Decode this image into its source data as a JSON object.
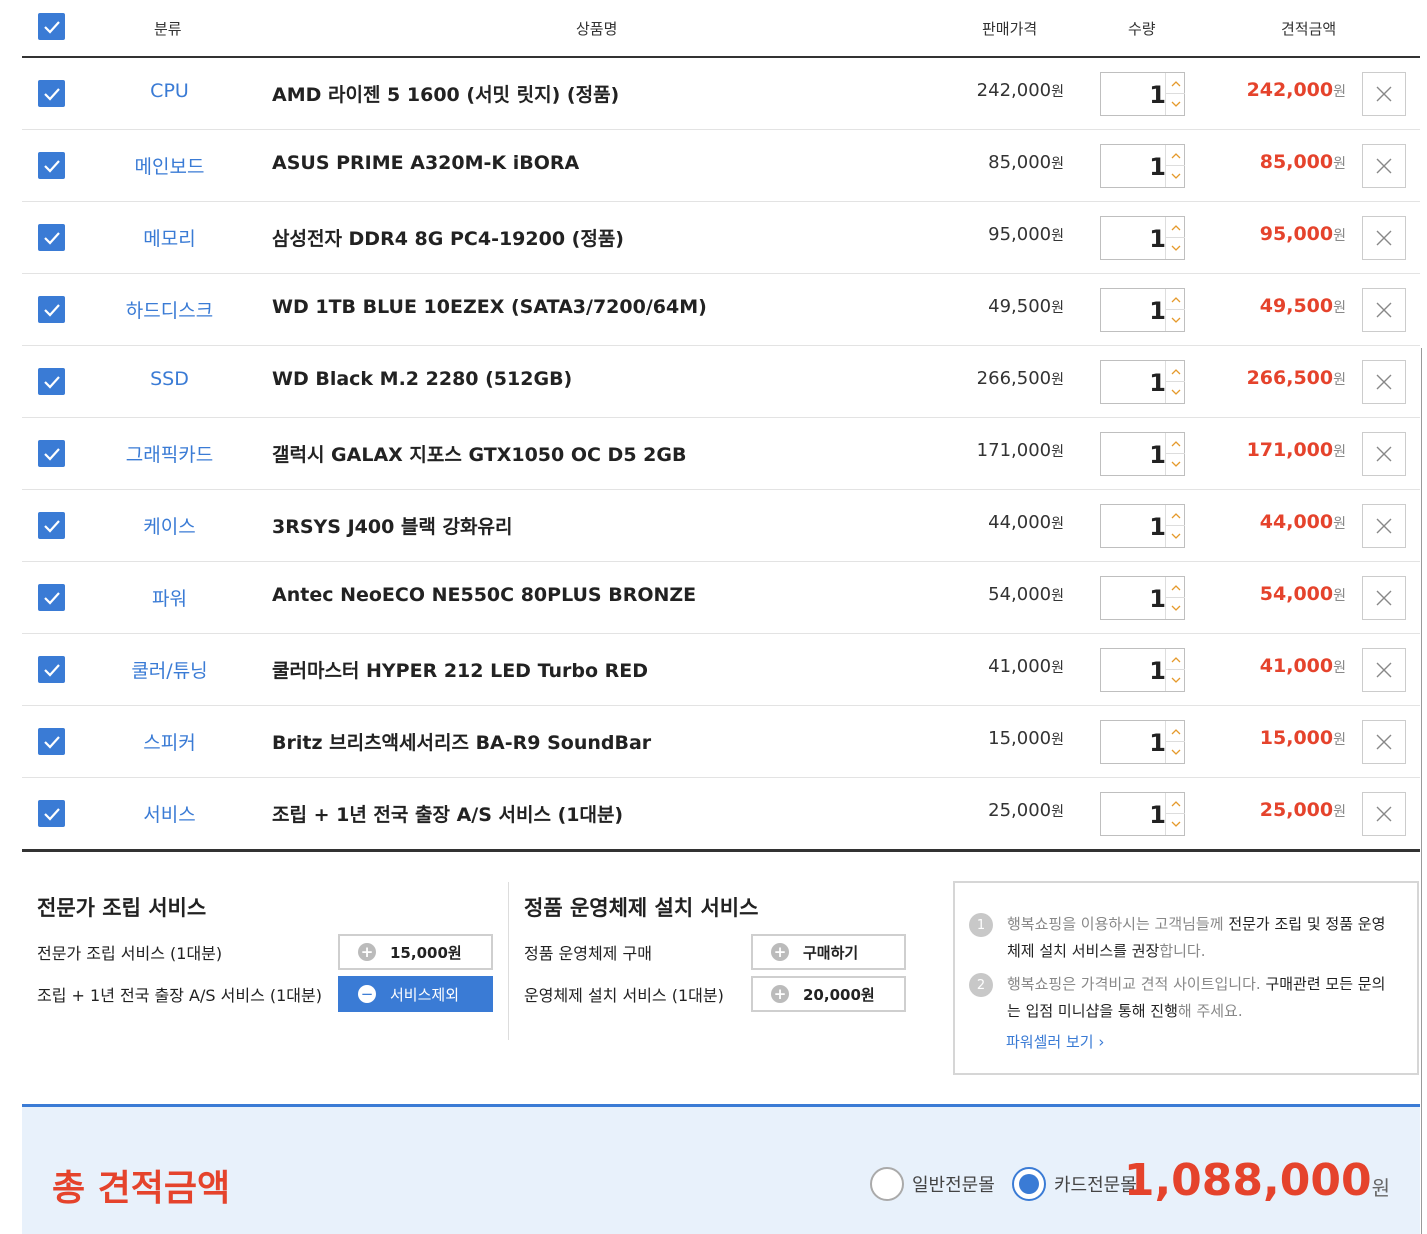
{
  "header": {
    "category": "분류",
    "product": "상품명",
    "price": "판매가격",
    "qty": "수량",
    "amount": "견적금액"
  },
  "won": "원",
  "rows": [
    {
      "category": "CPU",
      "name": "AMD 라이젠 5 1600 (서밋 릿지) (정품)",
      "price": "242,000",
      "qty": "1",
      "total": "242,000"
    },
    {
      "category": "메인보드",
      "name": "ASUS PRIME A320M-K iBORA",
      "price": "85,000",
      "qty": "1",
      "total": "85,000"
    },
    {
      "category": "메모리",
      "name": "삼성전자 DDR4 8G PC4-19200 (정품)",
      "price": "95,000",
      "qty": "1",
      "total": "95,000"
    },
    {
      "category": "하드디스크",
      "name": "WD 1TB BLUE 10EZEX (SATA3/7200/64M)",
      "price": "49,500",
      "qty": "1",
      "total": "49,500"
    },
    {
      "category": "SSD",
      "name": "WD Black M.2 2280 (512GB)",
      "price": "266,500",
      "qty": "1",
      "total": "266,500"
    },
    {
      "category": "그래픽카드",
      "name": "갤럭시 GALAX 지포스 GTX1050 OC D5 2GB",
      "price": "171,000",
      "qty": "1",
      "total": "171,000"
    },
    {
      "category": "케이스",
      "name": "3RSYS J400 블랙 강화유리",
      "price": "44,000",
      "qty": "1",
      "total": "44,000"
    },
    {
      "category": "파워",
      "name": "Antec NeoECO NE550C 80PLUS BRONZE",
      "price": "54,000",
      "qty": "1",
      "total": "54,000"
    },
    {
      "category": "쿨러/튜닝",
      "name": "쿨러마스터 HYPER 212 LED Turbo RED",
      "price": "41,000",
      "qty": "1",
      "total": "41,000"
    },
    {
      "category": "스피커",
      "name": "Britz 브리츠액세서리즈 BA-R9 SoundBar",
      "price": "15,000",
      "qty": "1",
      "total": "15,000"
    },
    {
      "category": "서비스",
      "name": "조립 + 1년 전국 출장 A/S 서비스 (1대분)",
      "price": "25,000",
      "qty": "1",
      "total": "25,000"
    }
  ],
  "assembly": {
    "title": "전문가 조립 서비스",
    "line1": "전문가 조립 서비스 (1대분)",
    "line1_button": "15,000원",
    "line2": "조립 + 1년 전국 출장 A/S 서비스 (1대분)",
    "line2_button": "서비스제외"
  },
  "os": {
    "title": "정품 운영체제 설치 서비스",
    "line1": "정품 운영체제 구매",
    "line1_button": "구매하기",
    "line2": "운영체제 설치 서비스 (1대분)",
    "line2_button": "20,000원"
  },
  "info": {
    "item1_num": "1",
    "item1_a": "행복쇼핑을 이용하시는 고객님들께 ",
    "item1_b": "전문가 조립 및 정품 운영체제 설치 서비스를 권장",
    "item1_c": "합니다.",
    "item2_num": "2",
    "item2_a": "행복쇼핑은 가격비교 견적 사이트입니다. ",
    "item2_b": "구매관련 모든 문의는 입점 미니샵을 통해 진행",
    "item2_c": "해 주세요.",
    "link": "파워셀러 보기 ›"
  },
  "total": {
    "label": "총 견적금액",
    "option1": "일반전문몰",
    "option2": "카드전문몰",
    "selected": "카드전문몰",
    "amount": "1,088,000",
    "won": "원"
  },
  "colors": {
    "accent": "#3a7bd5",
    "price_red": "#e5432c",
    "total_bg": "#e8f1fb"
  }
}
